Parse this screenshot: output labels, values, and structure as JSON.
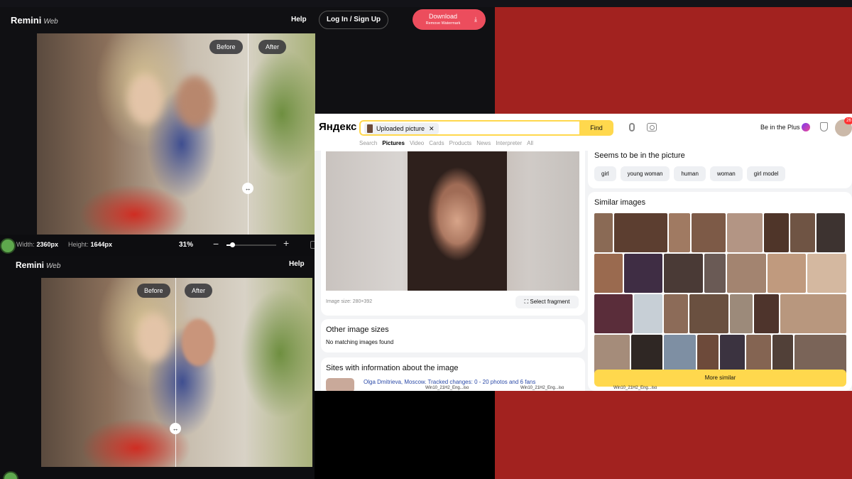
{
  "remini_top": {
    "brand": "Remini",
    "brand_suffix": "Web",
    "help": "Help",
    "login": "Log In / Sign Up",
    "download_label": "Download",
    "download_sub": "Remove Watermark",
    "before": "Before",
    "after": "After",
    "width_label": "Width:",
    "width_value": "2360px",
    "height_label": "Height:",
    "height_value": "1644px",
    "zoom": "31%",
    "zoom_level_fraction": 0.12
  },
  "remini_bottom": {
    "brand": "Remini",
    "brand_suffix": "Web",
    "help": "Help",
    "before": "Before",
    "after": "After"
  },
  "yandex": {
    "logo": "Яндекс",
    "search_chip": "Uploaded picture",
    "find": "Find",
    "plus": "Be in the Plus",
    "badge": "26",
    "tabs": [
      "Search",
      "Pictures",
      "Video",
      "Cards",
      "Products",
      "News",
      "Interpreter",
      "All"
    ],
    "active_tab": "Pictures",
    "image_size": "Image size: 280×392",
    "select_fragment": "Select fragment",
    "other_sizes_title": "Other image sizes",
    "other_sizes_sub": "No matching images found",
    "sites_title": "Sites with information about the image",
    "sites_link": "Olga Dmitrieva, Moscow. Tracked changes: 0 - 20 photos and 6 fans",
    "seems_title": "Seems to be in the picture",
    "tags": [
      "girl",
      "young woman",
      "human",
      "woman",
      "girl model"
    ],
    "similar_title": "Similar images",
    "more_similar": "More similar",
    "taskbar": [
      "Win10_21H2_Eng...iso",
      "Win10_21H2_Eng...iso",
      "Win10_21H2_Eng...iso"
    ]
  },
  "colors": {
    "remini_accent": "#ec4d5d",
    "yandex_yellow": "#ffd84d",
    "background_red": "#a2221f"
  }
}
